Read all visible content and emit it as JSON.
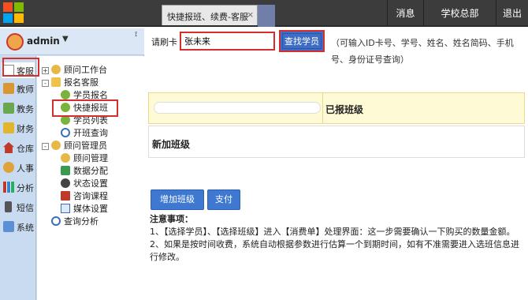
{
  "topbar": {
    "tab_label": "快捷报班、续费-客服",
    "tab_close": "×",
    "buttons": [
      "消息",
      "学校总部",
      "退出"
    ]
  },
  "user": {
    "name": "admin",
    "caret": "▼",
    "pin": "📌"
  },
  "left_nav": {
    "items": [
      "客服",
      "教师",
      "教务",
      "财务",
      "仓库",
      "人事",
      "分析",
      "短信",
      "系统"
    ],
    "active": "客服"
  },
  "tree": {
    "nodes": [
      {
        "label": "顾问工作台",
        "level": 0,
        "expander": "+"
      },
      {
        "label": "报名客服",
        "level": 0,
        "expander": "-"
      },
      {
        "label": "学员报名",
        "level": 1
      },
      {
        "label": "快捷报班",
        "level": 1,
        "selected": true
      },
      {
        "label": "学员列表",
        "level": 1
      },
      {
        "label": "开班查询",
        "level": 1
      },
      {
        "label": "顾问管理员",
        "level": 0,
        "expander": "-"
      },
      {
        "label": "顾问管理",
        "level": 1
      },
      {
        "label": "数据分配",
        "level": 1
      },
      {
        "label": "状态设置",
        "level": 1
      },
      {
        "label": "咨询课程",
        "level": 1
      },
      {
        "label": "媒体设置",
        "level": 1
      },
      {
        "label": "查询分析",
        "level": 0
      }
    ]
  },
  "main": {
    "card_label": "请刷卡",
    "card_value": "张未来",
    "find_button": "查找学员",
    "hint": "（可输入ID卡号、学号、姓名、姓名简码、手机号、身份证号查询）",
    "enrolled_title": "已报班级",
    "add_title": "新加班级",
    "add_button": "增加班级",
    "pay_button": "支付",
    "notes_title": "注意事项：",
    "notes": [
      "1、【选择学员】、【选择班级】进入【消费单】处理界面：这一步需要确认一下购买的数量金额。",
      "2、如果是按时间收费，系统自动根据参数进行估算一个到期时间，如有不准需要进入选班信息进行修改。"
    ]
  },
  "colors": {
    "accent": "#3f78d0",
    "highlight": "#d32f2f",
    "topbar": "#3c3c3c"
  }
}
